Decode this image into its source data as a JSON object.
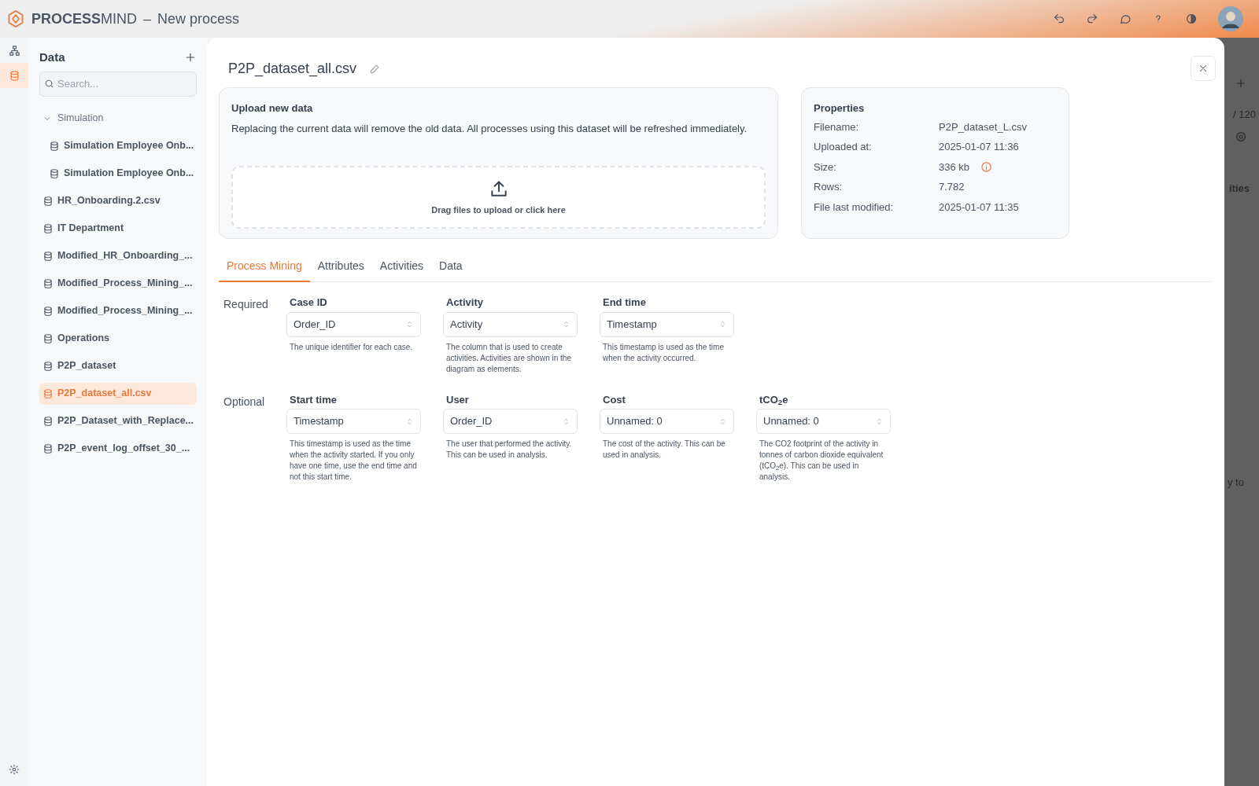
{
  "app": {
    "brand_bold": "PROCESS",
    "brand_light": "MIND",
    "separator": "–",
    "title": "New process"
  },
  "rail": [
    {
      "kind": "diagram",
      "selected": false
    },
    {
      "kind": "data",
      "selected": true
    }
  ],
  "sidebar": {
    "title": "Data",
    "search": {
      "placeholder": "Search..."
    },
    "items": [
      {
        "label": "Simulation",
        "kind": "folder",
        "expanded": true,
        "selected": false,
        "children": [
          {
            "label": "Simulation Employee Onb...",
            "kind": "dataset",
            "selected": false
          },
          {
            "label": "Simulation Employee Onb...",
            "kind": "dataset",
            "selected": false
          }
        ]
      },
      {
        "label": "HR_Onboarding.2.csv",
        "kind": "dataset",
        "selected": false
      },
      {
        "label": "IT Department",
        "kind": "dataset",
        "selected": false
      },
      {
        "label": "Modified_HR_Onboarding_...",
        "kind": "dataset",
        "selected": false
      },
      {
        "label": "Modified_Process_Mining_...",
        "kind": "dataset",
        "selected": false
      },
      {
        "label": "Modified_Process_Mining_...",
        "kind": "dataset",
        "selected": false
      },
      {
        "label": "Operations",
        "kind": "dataset",
        "selected": false
      },
      {
        "label": "P2P_dataset",
        "kind": "dataset",
        "selected": false
      },
      {
        "label": "P2P_dataset_all.csv",
        "kind": "dataset",
        "selected": true
      },
      {
        "label": "P2P_Dataset_with_Replace...",
        "kind": "dataset",
        "selected": false
      },
      {
        "label": "P2P_event_log_offset_30_...",
        "kind": "dataset",
        "selected": false
      }
    ]
  },
  "dataset": {
    "title": "P2P_dataset_all.csv"
  },
  "upload": {
    "title": "Upload new data",
    "description": "Replacing the current data will remove the old data. All processes using this dataset will be refreshed immediately.",
    "drop_label": "Drag files to upload or click here"
  },
  "properties": {
    "title": "Properties",
    "rows": [
      {
        "label": "Filename:",
        "value": "P2P_dataset_L.csv",
        "info": false
      },
      {
        "label": "Uploaded at:",
        "value": "2025-01-07 11:36",
        "info": false
      },
      {
        "label": "Size:",
        "value": "336 kb",
        "info": true
      },
      {
        "label": "Rows:",
        "value": "7.782",
        "info": false
      },
      {
        "label": "File last modified:",
        "value": "2025-01-07 11:35",
        "info": false
      }
    ]
  },
  "tabs": [
    {
      "label": "Process Mining",
      "selected": true
    },
    {
      "label": "Attributes",
      "selected": false
    },
    {
      "label": "Activities",
      "selected": false
    },
    {
      "label": "Data",
      "selected": false
    }
  ],
  "groups": [
    {
      "label": "Required",
      "fields": [
        {
          "label": "Case ID",
          "value": "Order_ID",
          "help": "The unique identifier for each case."
        },
        {
          "label": "Activity",
          "value": "Activity",
          "help": "The column that is used to create activities. Activities are shown in the diagram as elements."
        },
        {
          "label": "End time",
          "value": "Timestamp",
          "help": "This timestamp is used as the time when the activity occurred."
        }
      ]
    },
    {
      "label": "Optional",
      "fields": [
        {
          "label": "Start time",
          "value": "Timestamp",
          "help": "This timestamp is used as the time when the activity started. If you only have one time, use the end time and not this start time."
        },
        {
          "label": "User",
          "value": "Order_ID",
          "help": "The user that performed the activity. This can be used in analysis."
        },
        {
          "label": "Cost",
          "value": "Unnamed: 0",
          "help": "The cost of the activity. This can be used in analysis."
        },
        {
          "label": "tCO$_{2}$e",
          "value": "Unnamed: 0",
          "help": "The CO2 footprint of the activity in tonnes of carbon dioxide equivalent (tCO$_{2}$e). This can be used in analysis."
        }
      ]
    }
  ],
  "background_panel": {
    "count": "/ 120",
    "heading": "ities",
    "text": "y to"
  }
}
